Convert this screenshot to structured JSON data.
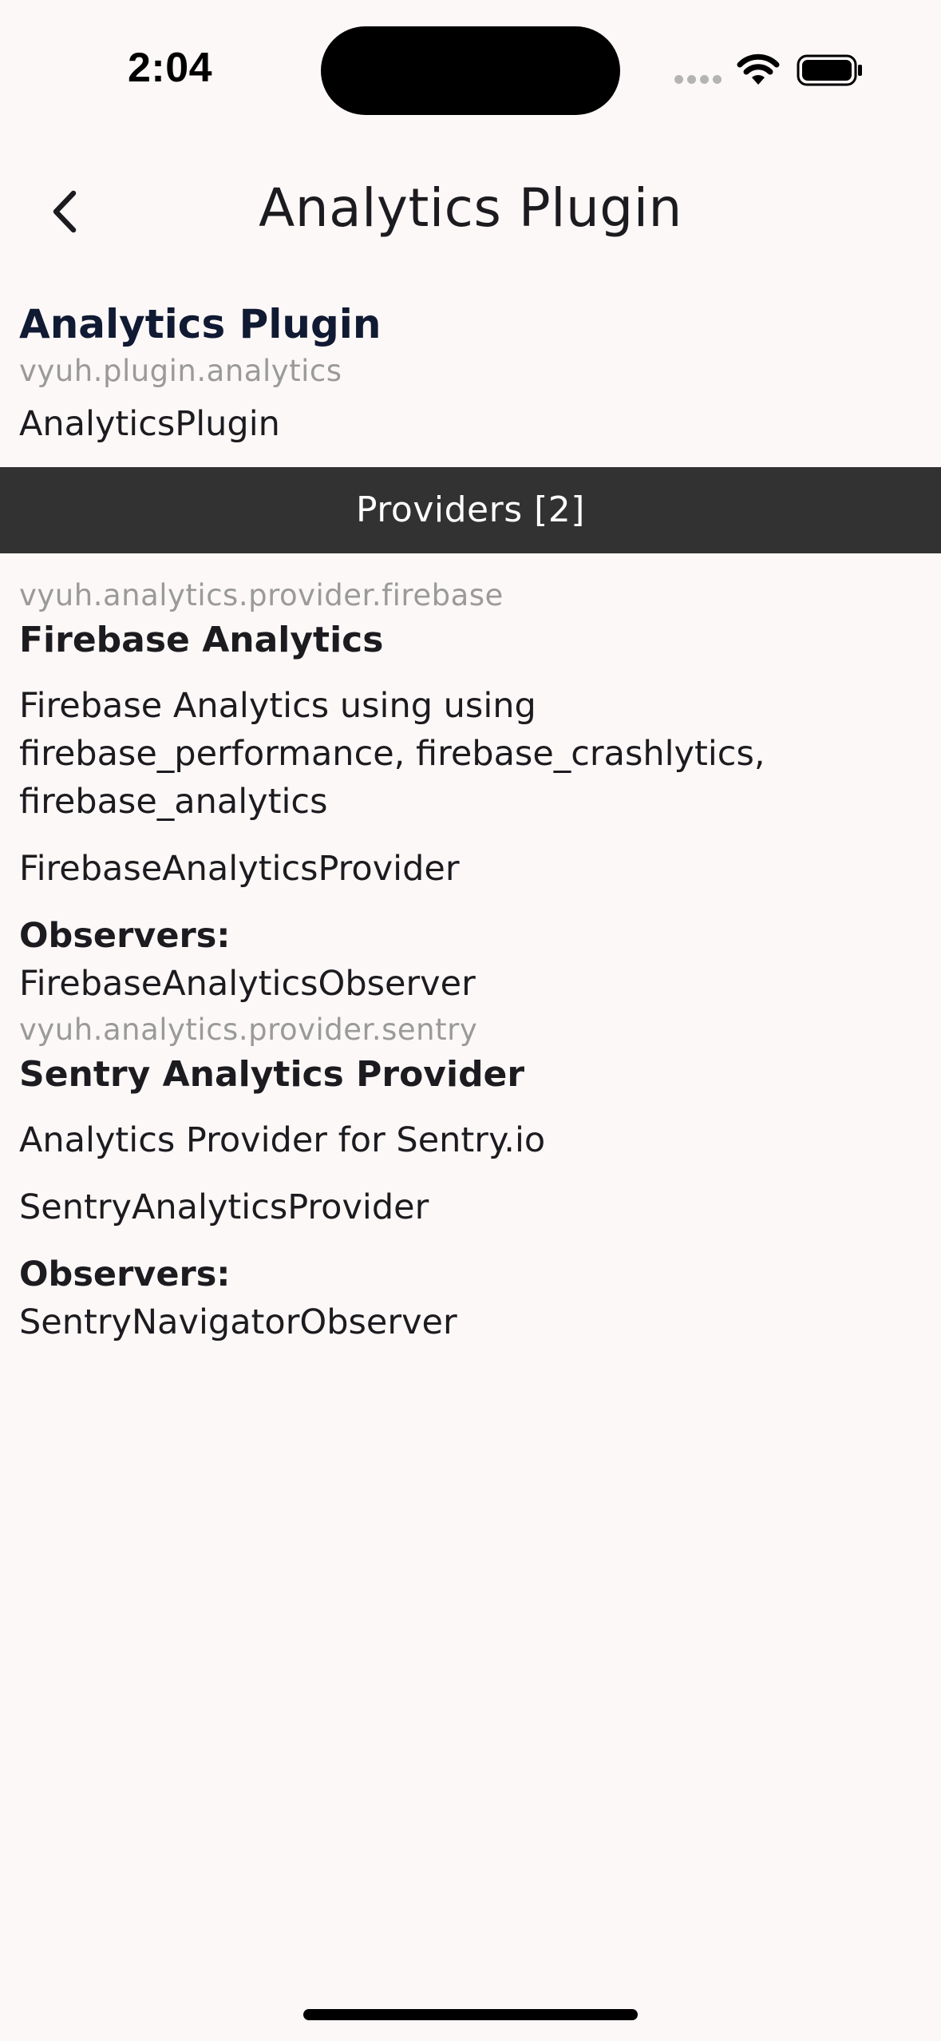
{
  "status_bar": {
    "time": "2:04"
  },
  "app_bar": {
    "title": "Analytics Plugin",
    "back_icon": "chevron-left-icon"
  },
  "plugin": {
    "title": "Analytics Plugin",
    "id": "vyuh.plugin.analytics",
    "class_name": "AnalyticsPlugin"
  },
  "providers_section": {
    "label": "Providers [2]"
  },
  "providers": [
    {
      "id": "vyuh.analytics.provider.firebase",
      "name": "Firebase Analytics",
      "description": "Firebase Analytics using using firebase_performance, firebase_crashlytics, firebase_analytics",
      "class_name": "FirebaseAnalyticsProvider",
      "observers_label": "Observers:",
      "observers": [
        "FirebaseAnalyticsObserver"
      ]
    },
    {
      "id": "vyuh.analytics.provider.sentry",
      "name": "Sentry Analytics Provider",
      "description": "Analytics Provider for Sentry.io",
      "class_name": "SentryAnalyticsProvider",
      "observers_label": "Observers:",
      "observers": [
        "SentryNavigatorObserver"
      ]
    }
  ],
  "colors": {
    "background": "#fcf8f7",
    "providers_bar": "#323232",
    "plugin_title": "#111a33",
    "muted_text": "#9a9a9a"
  }
}
